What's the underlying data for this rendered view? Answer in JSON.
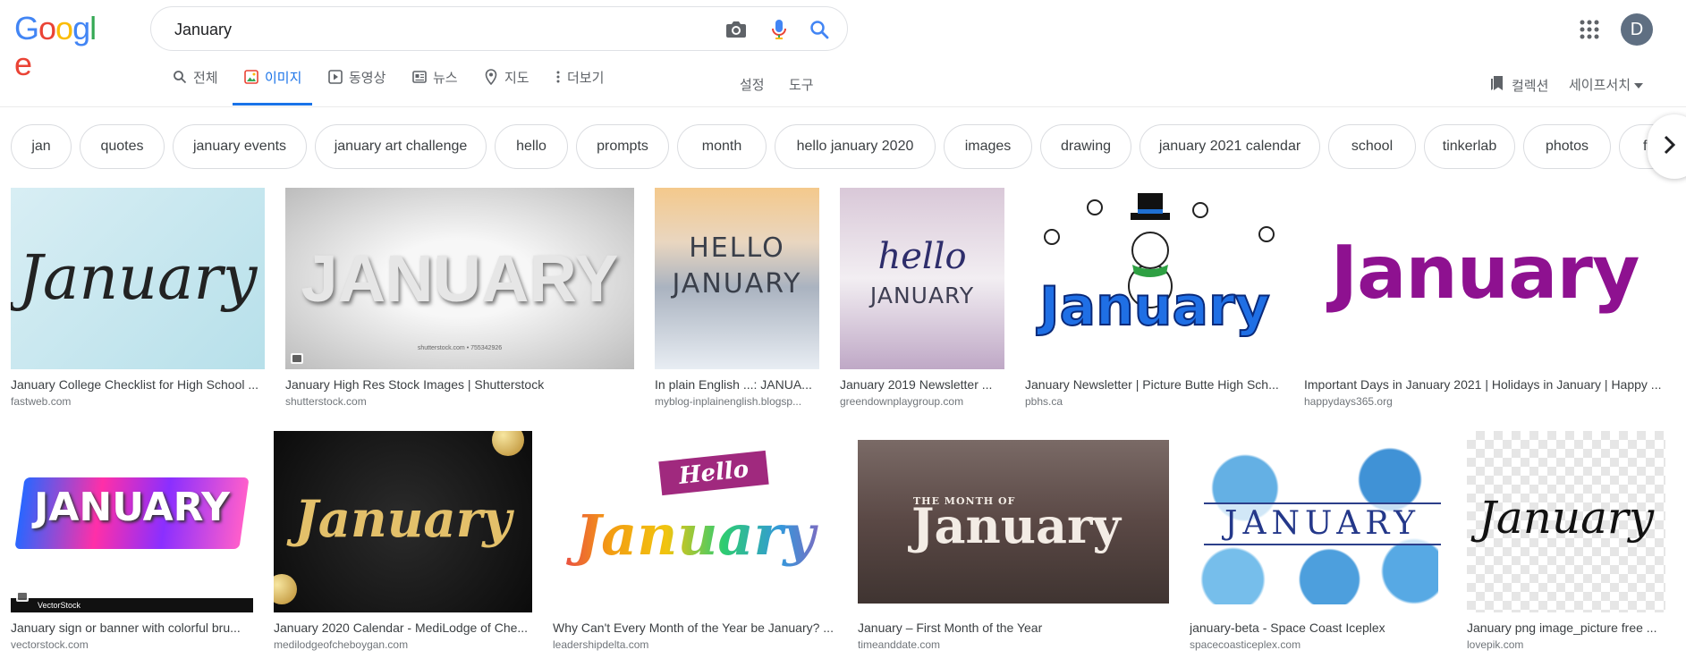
{
  "logo": {
    "text": "Google",
    "letters": [
      "G",
      "o",
      "o",
      "g",
      "l",
      "e"
    ],
    "colors": [
      "#4285F4",
      "#EA4335",
      "#FBBC05",
      "#4285F4",
      "#34A853",
      "#EA4335"
    ]
  },
  "search": {
    "value": "January",
    "placeholder": ""
  },
  "user": {
    "initial": "D"
  },
  "tabs": [
    {
      "label": "전체",
      "icon": "search-icon"
    },
    {
      "label": "이미지",
      "icon": "image-icon",
      "active": true
    },
    {
      "label": "동영상",
      "icon": "video-icon"
    },
    {
      "label": "뉴스",
      "icon": "news-icon"
    },
    {
      "label": "지도",
      "icon": "map-pin-icon"
    },
    {
      "label": "더보기",
      "icon": "more-vert-icon"
    }
  ],
  "tools": {
    "settings": "설정",
    "tools": "도구"
  },
  "right_links": {
    "collections": "컬렉션",
    "safesearch": "세이프서치"
  },
  "chips": [
    "jan",
    "quotes",
    "january events",
    "january art challenge",
    "hello",
    "prompts",
    "month",
    "hello january 2020",
    "images",
    "drawing",
    "january 2021 calendar",
    "school",
    "tinkerlab",
    "photos",
    "fonts"
  ],
  "results": [
    {
      "title": "January College Checklist for High School ...",
      "source": "fastweb.com",
      "thumb_text": "January"
    },
    {
      "title": "January High Res Stock Images | Shutterstock",
      "source": "shutterstock.com",
      "thumb_text": "JANUARY",
      "thumb_sub": "shutterstock.com • 755342926"
    },
    {
      "title": "In plain English ...: JANUA...",
      "source": "myblog-inplainenglish.blogsp...",
      "thumb_text": "HELLO",
      "thumb_text2": "JANUARY"
    },
    {
      "title": "January 2019 Newsletter ...",
      "source": "greendownplaygroup.com",
      "thumb_text": "hello",
      "thumb_text2": "JANUARY"
    },
    {
      "title": "January Newsletter | Picture Butte High Sch...",
      "source": "pbhs.ca",
      "thumb_text": "January"
    },
    {
      "title": "Important Days in January 2021 | Holidays in January | Happy ...",
      "source": "happydays365.org",
      "thumb_text": "January"
    },
    {
      "title": "January sign or banner with colorful bru...",
      "source": "vectorstock.com",
      "thumb_text": "JANUARY",
      "thumb_sub": "VectorStock"
    },
    {
      "title": "January 2020 Calendar - MediLodge of Che...",
      "source": "medilodgeofcheboygan.com",
      "thumb_text": "January"
    },
    {
      "title": "Why Can't Every Month of the Year be January? ...",
      "source": "leadershipdelta.com",
      "thumb_text": "Hello",
      "thumb_text2": "January"
    },
    {
      "title": "January – First Month of the Year",
      "source": "timeanddate.com",
      "thumb_text": "THE MONTH OF",
      "thumb_text2": "January"
    },
    {
      "title": "january-beta - Space Coast Iceplex",
      "source": "spacecoasticeplex.com",
      "thumb_text": "JANUARY"
    },
    {
      "title": "January png image_picture free ...",
      "source": "lovepik.com",
      "thumb_text": "January"
    }
  ]
}
